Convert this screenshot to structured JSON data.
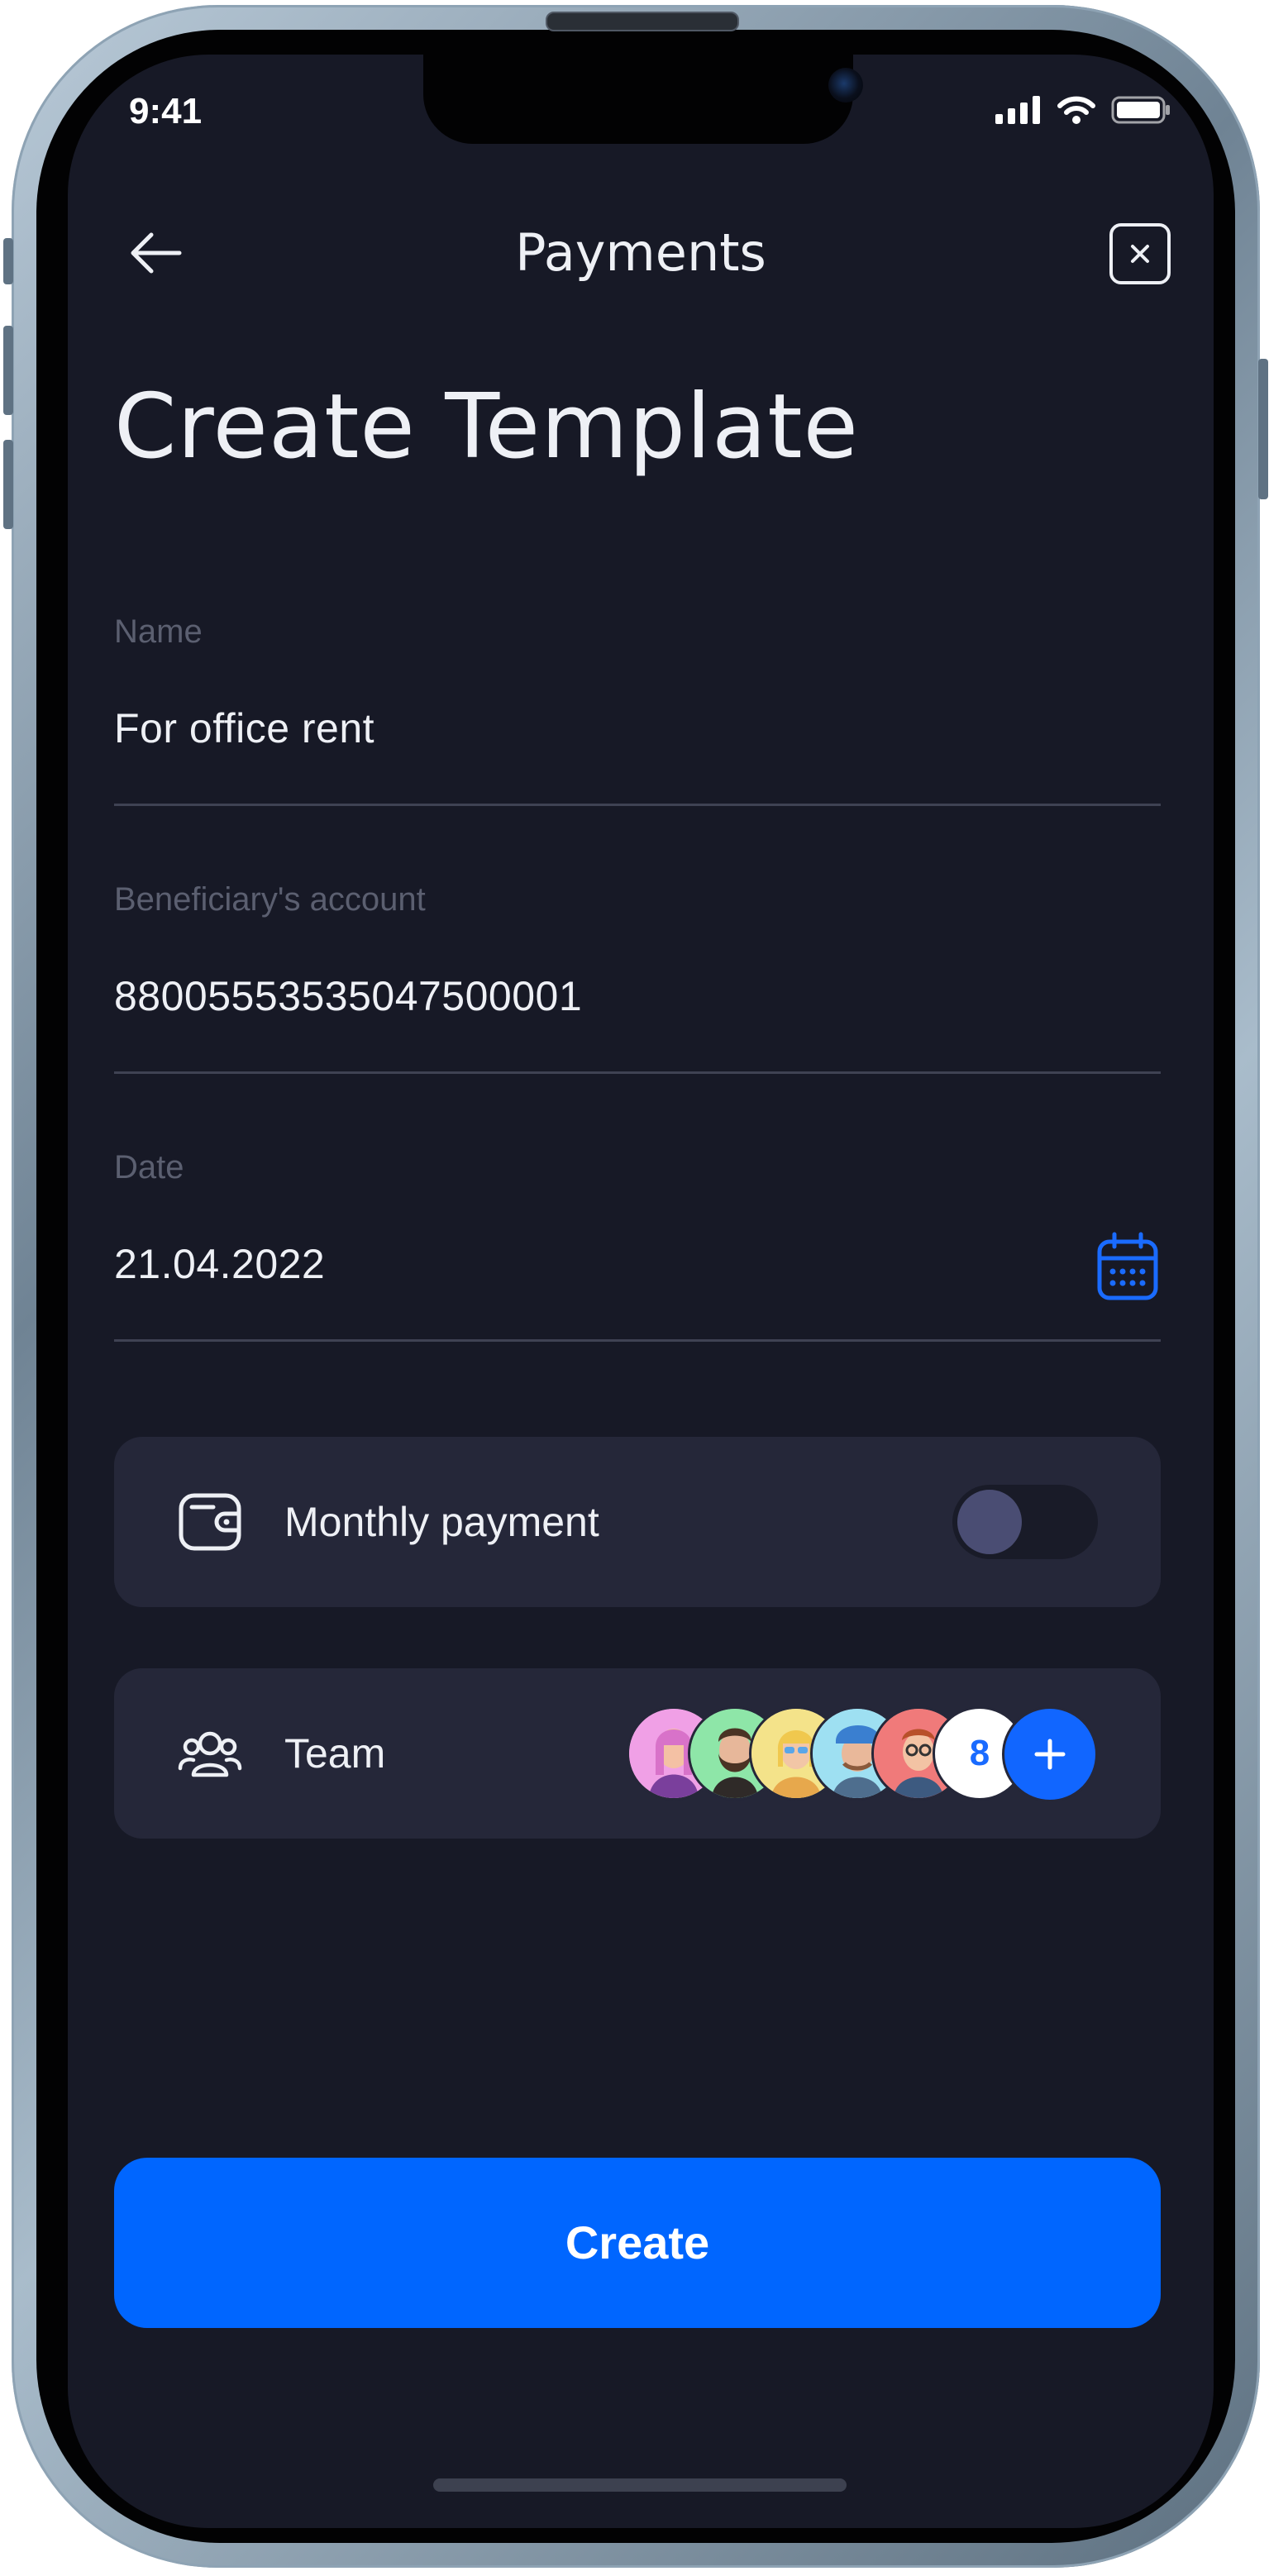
{
  "status_bar": {
    "time": "9:41",
    "icons": [
      "cellular-signal-icon",
      "wifi-icon",
      "battery-icon"
    ]
  },
  "nav": {
    "title": "Payments",
    "back_icon": "arrow-left-icon",
    "close_icon": "close-square-icon"
  },
  "page": {
    "title": "Create Template"
  },
  "fields": [
    {
      "label": "Name",
      "value": "For office rent"
    },
    {
      "label": "Beneficiary's account",
      "value": "88005553535047500001"
    },
    {
      "label": "Date",
      "value": "21.04.2022",
      "icon": "calendar-icon"
    }
  ],
  "monthly_payment": {
    "label": "Monthly payment",
    "icon": "wallet-icon",
    "enabled": false
  },
  "team": {
    "label": "Team",
    "icon": "people-group-icon",
    "avatars": [
      "avatar-1",
      "avatar-2",
      "avatar-3",
      "avatar-4",
      "avatar-5"
    ],
    "more_count": "8",
    "add_icon": "plus-icon"
  },
  "actions": {
    "create_label": "Create"
  },
  "colors": {
    "background": "#171926",
    "card": "#252739",
    "accent": "#0066ff",
    "text": "#eef0f5",
    "muted": "#5b5f70"
  }
}
